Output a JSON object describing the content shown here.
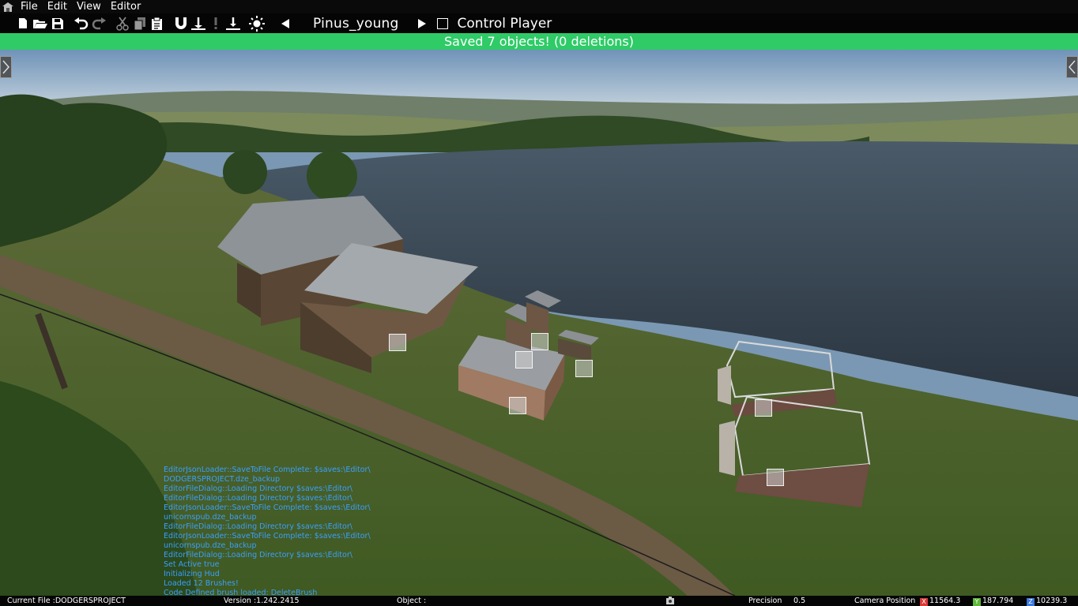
{
  "menu": {
    "items": [
      "File",
      "Edit",
      "View",
      "Editor"
    ]
  },
  "toolbar": {
    "buttons": [
      "new-file-icon",
      "open-folder-icon",
      "save-icon",
      "undo-icon",
      "redo-icon",
      "cut-icon",
      "copy-icon",
      "paste-icon",
      "magnet-snap-icon",
      "ground-snap-icon",
      "collision-icon",
      "drop-to-ground-icon",
      "sun-icon"
    ],
    "brush_name": "Pinus_young",
    "control_player_label": "Control Player",
    "control_player_checked": false
  },
  "banner": {
    "message": "Saved 7 objects! (0 deletions)",
    "color": "#2ecb67"
  },
  "console": {
    "color": "#3aa0ff",
    "lines": [
      "EditorJsonLoader::SaveToFile Complete: $saves:\\Editor\\",
      "DODGERSPROJECT.dze_backup",
      "EditorFileDialog::Loading Directory $saves:\\Editor\\",
      "EditorFileDialog::Loading Directory $saves:\\Editor\\",
      "EditorJsonLoader::SaveToFile Complete: $saves:\\Editor\\",
      "unicornspub.dze_backup",
      "EditorFileDialog::Loading Directory $saves:\\Editor\\",
      "EditorJsonLoader::SaveToFile Complete: $saves:\\Editor\\",
      "unicornspub.dze_backup",
      "EditorFileDialog::Loading Directory $saves:\\Editor\\",
      "Set Active true",
      "Initializing Hud",
      "Loaded 12 Brushes!",
      "Code Defined brush loaded: DeleteBrush"
    ]
  },
  "status": {
    "current_file": "Current File :DODGERSPROJECT",
    "version": "Version :1.242.2415",
    "object": "Object :",
    "precision_label": "Precision",
    "precision_value": "0.5",
    "camera_label": "Camera Position",
    "x_tag": "X",
    "x_value": "11564.3",
    "x_color": "#d93a3a",
    "y_tag": "Y",
    "y_value": "187.794",
    "y_color": "#5fb83a",
    "z_tag": "Z",
    "z_value": "10239.3",
    "z_color": "#3a78d9"
  }
}
